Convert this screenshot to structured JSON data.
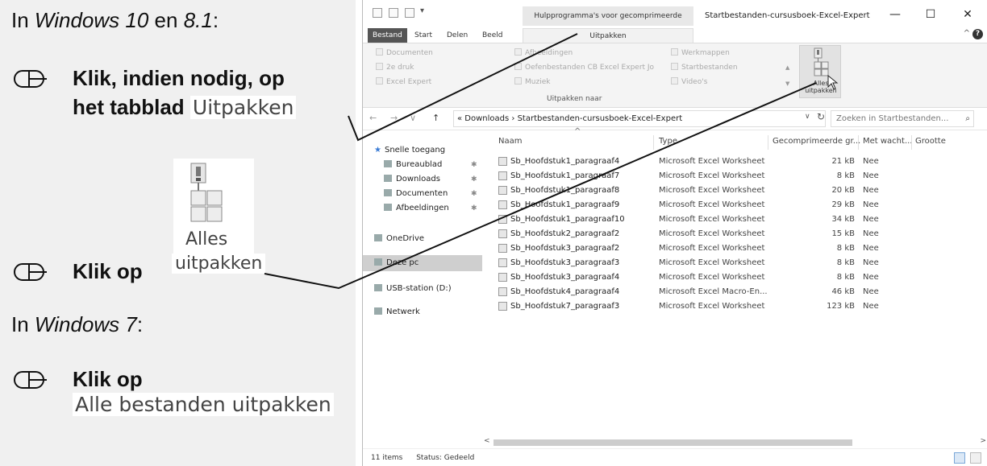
{
  "instructions": {
    "win10_prefix": "In ",
    "win10_os_a": "Windows 10",
    "win10_mid": " en ",
    "win10_os_b": "8.1",
    "win10_suffix": ":",
    "step1_line1": "Klik, indien nodig, op",
    "step1_line2": "het tabblad",
    "step1_tab_name": "Uitpakken",
    "zip_label_1": "Alles",
    "zip_label_2": "uitpakken",
    "step2_text": "Klik op",
    "win7_prefix": "In ",
    "win7_os": "Windows 7",
    "win7_suffix": ":",
    "step3_text": "Klik op",
    "step3_button": "Alle bestanden uitpakken"
  },
  "window": {
    "contextual_tab": "Hulpprogramma's voor gecomprimeerde mappen",
    "title": "Startbestanden-cursusboek-Excel-Expert",
    "minimize": "—",
    "maximize": "☐",
    "close": "✕"
  },
  "ribbon": {
    "tabs": [
      "Bestand",
      "Start",
      "Delen",
      "Beeld",
      "Uitpakken"
    ],
    "collapse": "^",
    "help": "?",
    "locations": [
      "Documenten",
      "Afbeeldingen",
      "Werkmappen",
      "2e druk",
      "Oefenbestanden CB Excel Expert Jo",
      "Startbestanden",
      "Excel Expert",
      "Muziek",
      "Video's"
    ],
    "group_label": "Uitpakken naar",
    "extract_all_line1": "Alles",
    "extract_all_line2": "uitpakken"
  },
  "address": {
    "back": "←",
    "forward": "→",
    "up": "↑",
    "path": "« Downloads › Startbestanden-cursusboek-Excel-Expert",
    "dropdown": "∨",
    "refresh": "↻",
    "search_placeholder": "Zoeken in Startbestanden...",
    "search_icon": "⌕"
  },
  "nav": {
    "items": [
      "Snelle toegang",
      "Bureaublad",
      "Downloads",
      "Documenten",
      "Afbeeldingen",
      "OneDrive",
      "Deze pc",
      "USB-station (D:)",
      "Netwerk"
    ]
  },
  "filelist": {
    "columns": [
      "Naam",
      "Type",
      "Gecomprimeerde gr...",
      "Met wacht...",
      "Grootte"
    ],
    "rows": [
      {
        "name": "Sb_Hoofdstuk1_paragraaf4",
        "type": "Microsoft Excel Worksheet",
        "size": "21 kB",
        "pw": "Nee"
      },
      {
        "name": "Sb_Hoofdstuk1_paragraaf7",
        "type": "Microsoft Excel Worksheet",
        "size": "8 kB",
        "pw": "Nee"
      },
      {
        "name": "Sb_Hoofdstuk1_paragraaf8",
        "type": "Microsoft Excel Worksheet",
        "size": "20 kB",
        "pw": "Nee"
      },
      {
        "name": "Sb_Hoofdstuk1_paragraaf9",
        "type": "Microsoft Excel Worksheet",
        "size": "29 kB",
        "pw": "Nee"
      },
      {
        "name": "Sb_Hoofdstuk1_paragraaf10",
        "type": "Microsoft Excel Worksheet",
        "size": "34 kB",
        "pw": "Nee"
      },
      {
        "name": "Sb_Hoofdstuk2_paragraaf2",
        "type": "Microsoft Excel Worksheet",
        "size": "15 kB",
        "pw": "Nee"
      },
      {
        "name": "Sb_Hoofdstuk3_paragraaf2",
        "type": "Microsoft Excel Worksheet",
        "size": "8 kB",
        "pw": "Nee"
      },
      {
        "name": "Sb_Hoofdstuk3_paragraaf3",
        "type": "Microsoft Excel Worksheet",
        "size": "8 kB",
        "pw": "Nee"
      },
      {
        "name": "Sb_Hoofdstuk3_paragraaf4",
        "type": "Microsoft Excel Worksheet",
        "size": "8 kB",
        "pw": "Nee"
      },
      {
        "name": "Sb_Hoofdstuk4_paragraaf4",
        "type": "Microsoft Excel Macro-En...",
        "size": "46 kB",
        "pw": "Nee"
      },
      {
        "name": "Sb_Hoofdstuk7_paragraaf3",
        "type": "Microsoft Excel Worksheet",
        "size": "123 kB",
        "pw": "Nee"
      }
    ]
  },
  "status": {
    "count": "11 items",
    "status_text": "Status: Gedeeld"
  },
  "colors": {
    "panel_bg": "#f0f0f0",
    "selected_nav_bg": "#cfcfcf",
    "titlebar_contextual": "#e8e8e8"
  }
}
